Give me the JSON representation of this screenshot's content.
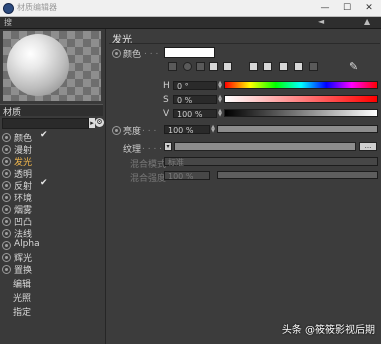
{
  "window": {
    "title": "材质编辑器",
    "minimize": "—",
    "maximize": "☐",
    "close": "✕"
  },
  "menubar": {
    "menu": "搜",
    "nav_left": "◄",
    "nav_up": "▲"
  },
  "left": {
    "material_name_label": "材质",
    "material_name_value": "",
    "channels": [
      {
        "label": "颜色",
        "checked": "✔"
      },
      {
        "label": "漫射",
        "checked": ""
      },
      {
        "label": "发光",
        "checked": ""
      },
      {
        "label": "透明",
        "checked": ""
      },
      {
        "label": "反射",
        "checked": "✔"
      },
      {
        "label": "环境",
        "checked": ""
      },
      {
        "label": "烟雾",
        "checked": ""
      },
      {
        "label": "凹凸",
        "checked": ""
      },
      {
        "label": "法线",
        "checked": ""
      },
      {
        "label": "Alpha",
        "checked": ""
      },
      {
        "label": "辉光",
        "checked": ""
      },
      {
        "label": "置换",
        "checked": ""
      }
    ],
    "extra_items": [
      "编辑",
      "光照",
      "指定"
    ]
  },
  "right": {
    "section_title": "发光",
    "color_label": "颜色",
    "color_dots": ". . .",
    "swatch_color": "#ffffff",
    "h_label": "H",
    "h_value": "0 °",
    "s_label": "S",
    "s_value": "0 %",
    "v_label": "V",
    "v_value": "100 %",
    "brightness_label": "亮度",
    "brightness_dots": ". . .",
    "brightness_value": "100 %",
    "texture_label": "纹理",
    "texture_dots": ". . . . .",
    "texture_button": "...",
    "blend_mode_label": "混合模式",
    "blend_mode_value": "标准",
    "blend_strength_label": "混合强度",
    "blend_strength_value": "100 %"
  },
  "watermark": "头条 @筱筱影视后期",
  "colors": {
    "active_channel": "#f2b84d",
    "panel_bg": "#3c3c3c"
  }
}
